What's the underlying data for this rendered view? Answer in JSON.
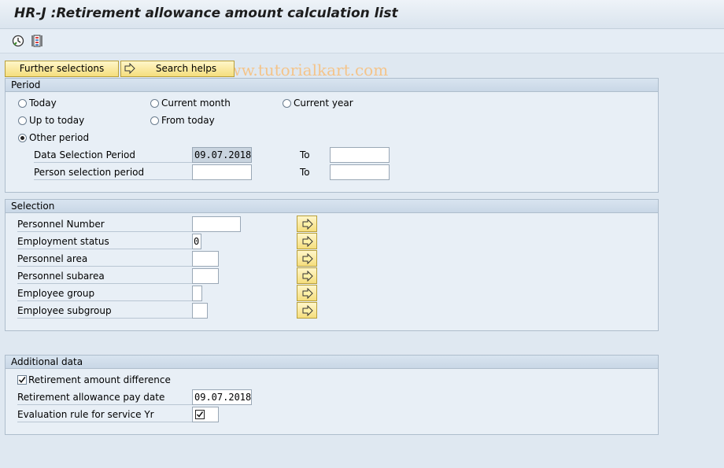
{
  "window": {
    "title": "HR-J :Retirement allowance amount calculation list"
  },
  "toolbar": {
    "icons": [
      "execute-icon",
      "program-documentation-icon"
    ]
  },
  "watermark": "© www.tutorialkart.com",
  "buttons": {
    "further_selections": "Further selections",
    "search_helps": "Search helps"
  },
  "period": {
    "header": "Period",
    "options": {
      "today": "Today",
      "current_month": "Current month",
      "current_year": "Current year",
      "up_to_today": "Up to today",
      "from_today": "From today",
      "other_period": "Other period"
    },
    "selected": "other_period",
    "data_selection_label": "Data Selection Period",
    "data_selection_from": "09.07.2018",
    "data_selection_to": "",
    "person_selection_label": "Person selection period",
    "person_selection_from": "",
    "person_selection_to": "",
    "to_label": "To"
  },
  "selection": {
    "header": "Selection",
    "rows": [
      {
        "label": "Personnel Number",
        "value": ""
      },
      {
        "label": "Employment status",
        "value": "0"
      },
      {
        "label": "Personnel area",
        "value": ""
      },
      {
        "label": "Personnel subarea",
        "value": ""
      },
      {
        "label": "Employee group",
        "value": ""
      },
      {
        "label": "Employee subgroup",
        "value": ""
      }
    ]
  },
  "additional": {
    "header": "Additional data",
    "retirement_diff_label": "Retirement amount difference",
    "retirement_diff_checked": true,
    "pay_date_label": "Retirement allowance pay date",
    "pay_date_value": "09.07.2018",
    "eval_rule_label": "Evaluation rule for service Yr",
    "eval_rule_checked": true
  }
}
